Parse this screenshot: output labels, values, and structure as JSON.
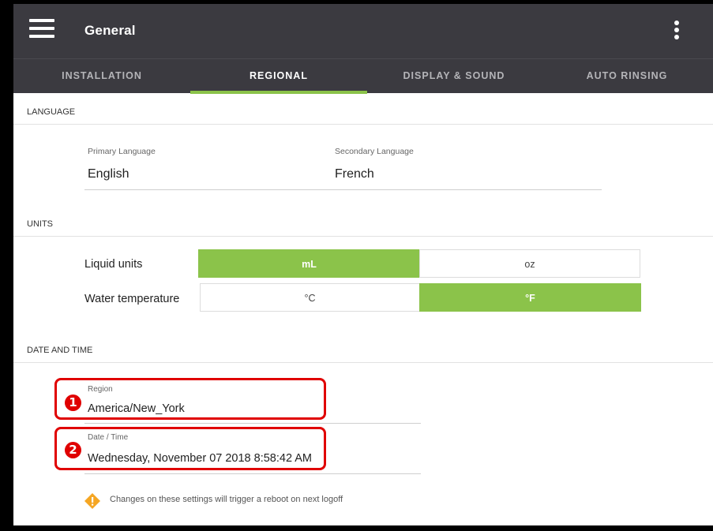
{
  "header": {
    "title": "General",
    "menu_icon": "hamburger-menu-icon",
    "more_icon": "more-vertical-icon"
  },
  "tabs": [
    {
      "label": "INSTALLATION",
      "active": false
    },
    {
      "label": "REGIONAL",
      "active": true
    },
    {
      "label": "DISPLAY & SOUND",
      "active": false
    },
    {
      "label": "AUTO RINSING",
      "active": false
    }
  ],
  "language": {
    "section_title": "LANGUAGE",
    "primary_label": "Primary Language",
    "primary_value": "English",
    "secondary_label": "Secondary Language",
    "secondary_value": "French"
  },
  "units": {
    "section_title": "UNITS",
    "liquid": {
      "label": "Liquid units",
      "options": [
        "mL",
        "oz"
      ],
      "selected": "mL"
    },
    "temperature": {
      "label": "Water temperature",
      "options": [
        "°C",
        "°F"
      ],
      "selected": "°F"
    }
  },
  "datetime": {
    "section_title": "DATE AND TIME",
    "region_label": "Region",
    "region_value": "America/New_York",
    "datetime_label": "Date / Time",
    "datetime_value": "Wednesday, November 07 2018 8:58:42 AM"
  },
  "callouts": [
    "1",
    "2"
  ],
  "warning": {
    "icon": "warning-diamond-icon",
    "text": "Changes on these settings will trigger a reboot on next logoff"
  },
  "colors": {
    "accent": "#8bc34a",
    "appbar": "#3b3a40",
    "callout": "#e00000",
    "warning": "#f5a623"
  }
}
